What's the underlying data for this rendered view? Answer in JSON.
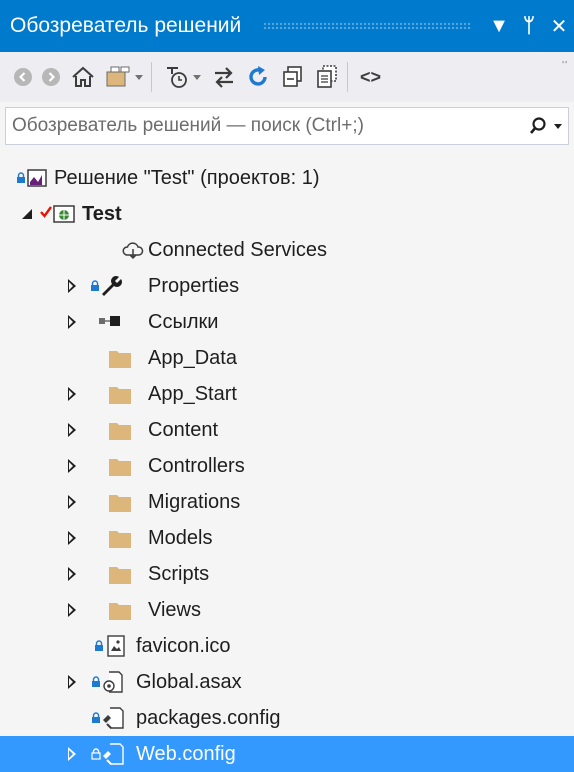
{
  "window": {
    "title": "Обозреватель решений"
  },
  "titlebar_buttons": {
    "dropdown": "▼",
    "pin": "ᛘ",
    "close": "✕"
  },
  "toolbar": {
    "code": "<>",
    "overflow": "''"
  },
  "search": {
    "placeholder": "Обозреватель решений — поиск (Ctrl+;)"
  },
  "tree": {
    "solution": "Решение \"Test\"  (проектов: 1)",
    "project": "Test",
    "items": [
      {
        "label": "Connected Services"
      },
      {
        "label": "Properties"
      },
      {
        "label": "Ссылки"
      },
      {
        "label": "App_Data"
      },
      {
        "label": "App_Start"
      },
      {
        "label": "Content"
      },
      {
        "label": "Controllers"
      },
      {
        "label": "Migrations"
      },
      {
        "label": "Models"
      },
      {
        "label": "Scripts"
      },
      {
        "label": "Views"
      },
      {
        "label": "favicon.ico"
      },
      {
        "label": "Global.asax"
      },
      {
        "label": "packages.config"
      },
      {
        "label": "Web.config"
      }
    ]
  },
  "colors": {
    "accent": "#007acc",
    "selection": "#3399ff",
    "folder": "#dcb67a",
    "background": "#f5f5f5"
  }
}
